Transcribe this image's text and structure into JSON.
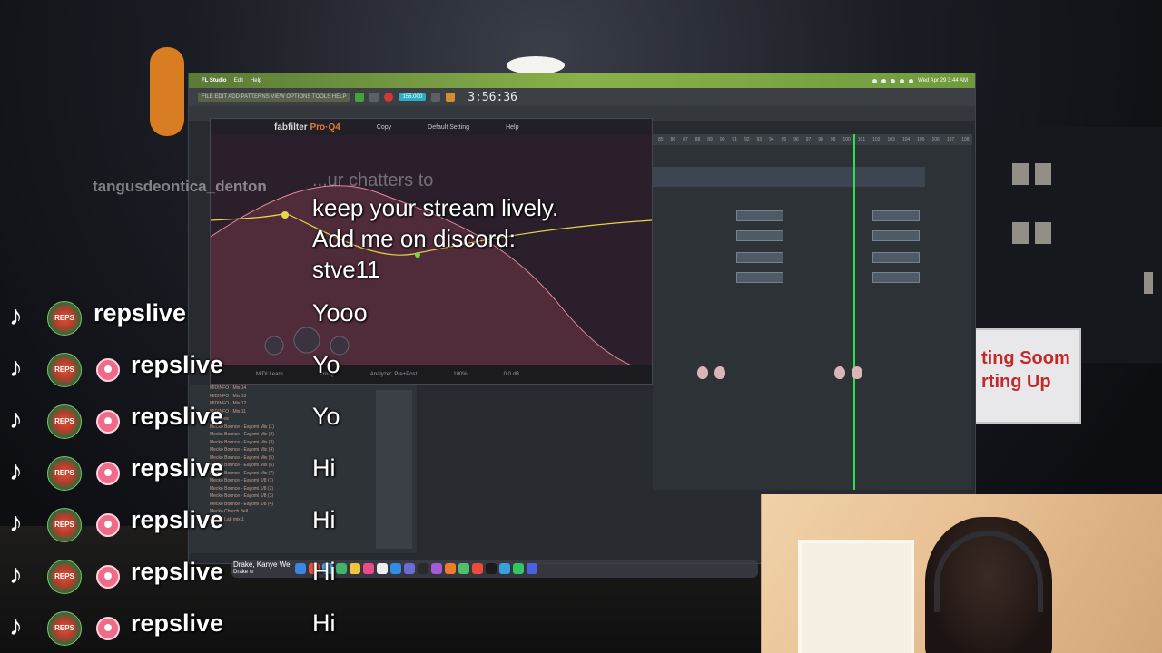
{
  "stream": {
    "overlay_lines": [
      "keep your stream lively.",
      "Add me on discord:",
      "stve11"
    ],
    "faint_line": "...ur chatters to",
    "ghost_username": "tangusdeontica_denton"
  },
  "chat": [
    {
      "username": "repslive",
      "message": "Yooo",
      "has_badge": false
    },
    {
      "username": "repslive",
      "message": "Yo",
      "has_badge": true
    },
    {
      "username": "repslive",
      "message": "Yo",
      "has_badge": true
    },
    {
      "username": "repslive",
      "message": "Hi",
      "has_badge": true
    },
    {
      "username": "repslive",
      "message": "Hi",
      "has_badge": true
    },
    {
      "username": "repslive",
      "message": "Hi",
      "has_badge": true
    },
    {
      "username": "repslive",
      "message": "Hi",
      "has_badge": true
    }
  ],
  "avatar_text": "REPS",
  "macos": {
    "app_name": "FL Studio",
    "menus": [
      "Edit",
      "Help"
    ],
    "clock": "Wed Apr 29 3:44 AM"
  },
  "fl": {
    "menu": "FILE EDIT ADD PATTERNS VIEW OPTIONS TOOLS HELP",
    "tempo": "155.000",
    "time": "3:56:36",
    "playlist_ruler": [
      "85",
      "86",
      "87",
      "88",
      "89",
      "90",
      "91",
      "92",
      "93",
      "94",
      "95",
      "96",
      "97",
      "98",
      "99",
      "100",
      "101",
      "102",
      "103",
      "104",
      "105",
      "106",
      "107",
      "108"
    ]
  },
  "plugin": {
    "brand": "fabfilter",
    "product": "Pro·Q",
    "version": "4",
    "preset_label": "Default Setting",
    "copy": "Copy",
    "help": "Help",
    "footer_left": "MIDI Learn",
    "footer_mid": "Pro-Q",
    "footer_right": "Analyzer: Pre+Post",
    "zoom": "100%",
    "db": "0.0 dB"
  },
  "browser_items": [
    "MIDINFO - Mix 14",
    "MIDINFO - Mix 13",
    "MIDINFO - Mix 12",
    "MIDINFO - Mix 11",
    "...d Skies",
    "Mecko Bounce - Eayomi Mix (1)",
    "Mecko Bounce - Eayomi Mix (2)",
    "Mecko Bounce - Eayomi Mix (3)",
    "Mecko Bounce - Eayomi Mix (4)",
    "Mecko Bounce - Eayomi Mix (5)",
    "Mecko Bounce - Eayomi Mix (6)",
    "Mecko Bounce - Eayomi Mix (7)",
    "Mecko Bounce - Eayomi 1/8 (1)",
    "Mecko Bounce - Eayomi 1/8 (2)",
    "Mecko Bounce - Eayomi 1/8 (3)",
    "Mecko Bounce - Eayomi 1/8 (4)",
    "Mecko Church Bell",
    "Mecko Lab mix 1"
  ],
  "dock": {
    "now_playing_title": "Drake, Kanye We",
    "now_playing_sub": "Drake ⊙"
  },
  "sign_text": [
    "ting Soom",
    "rting Up"
  ],
  "colors": {
    "accent_green": "#2ee14a",
    "proq_orange": "#e07b39",
    "menubar_green": "#8ab04a"
  }
}
